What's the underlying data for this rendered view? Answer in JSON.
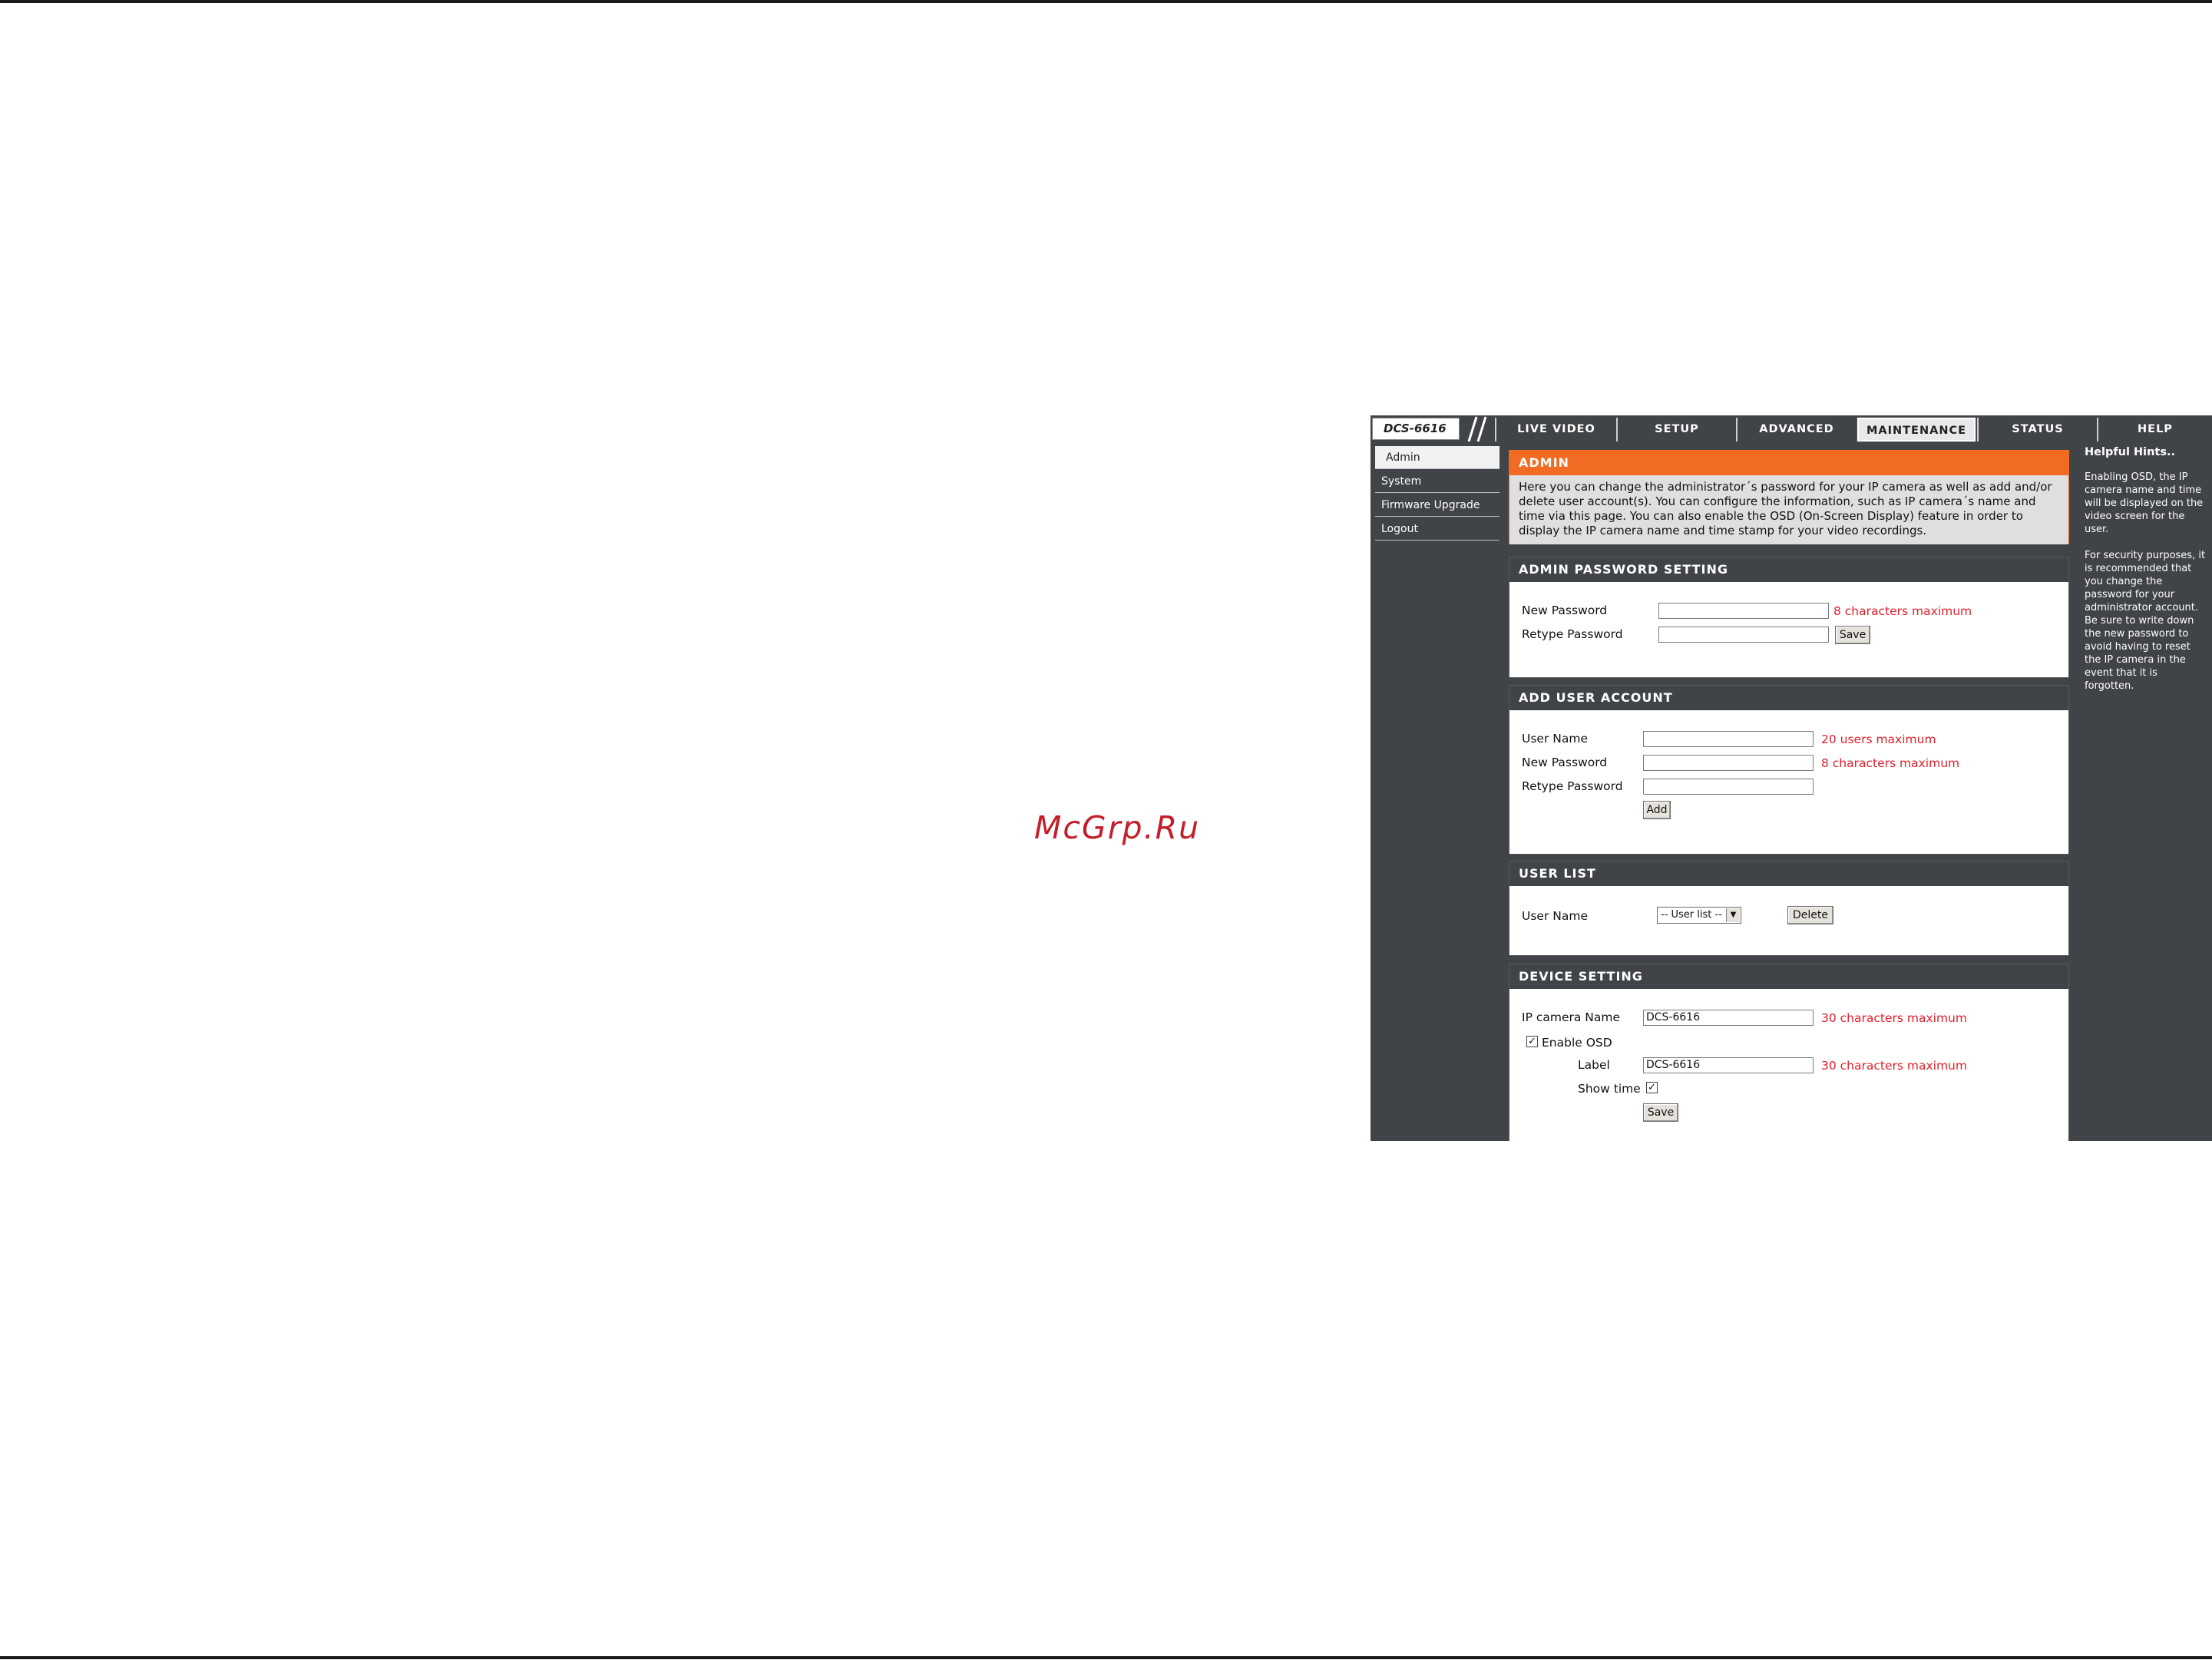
{
  "watermark": "McGrp.Ru",
  "device": {
    "model": "DCS-6616"
  },
  "tabs": [
    {
      "label": "LIVE VIDEO",
      "active": false
    },
    {
      "label": "SETUP",
      "active": false
    },
    {
      "label": "ADVANCED",
      "active": false
    },
    {
      "label": "MAINTENANCE",
      "active": true
    },
    {
      "label": "STATUS",
      "active": false
    },
    {
      "label": "HELP",
      "active": false
    }
  ],
  "sidebar": {
    "items": [
      {
        "label": "Admin",
        "active": true
      },
      {
        "label": "System",
        "active": false
      },
      {
        "label": "Firmware Upgrade",
        "active": false
      },
      {
        "label": "Logout",
        "active": false
      }
    ]
  },
  "admin": {
    "title": "ADMIN",
    "description": "Here you can change the administrator´s password for your IP camera as well as add and/or delete user account(s). You can configure the information, such as IP camera´s name and time via this page. You can also enable the OSD (On-Screen Display) feature in order to display the IP camera name and time stamp for your video recordings."
  },
  "admin_password": {
    "title": "ADMIN PASSWORD SETTING",
    "new_password_label": "New Password",
    "new_password_value": "",
    "new_password_hint": "8 characters maximum",
    "retype_password_label": "Retype Password",
    "retype_password_value": "",
    "save_label": "Save"
  },
  "add_user": {
    "title": "ADD USER ACCOUNT",
    "user_name_label": "User Name",
    "user_name_value": "",
    "user_name_hint": "20 users maximum",
    "new_password_label": "New Password",
    "new_password_value": "",
    "new_password_hint": "8 characters maximum",
    "retype_password_label": "Retype Password",
    "retype_password_value": "",
    "add_label": "Add"
  },
  "user_list": {
    "title": "USER LIST",
    "user_name_label": "User Name",
    "selected": "-- User list --",
    "delete_label": "Delete"
  },
  "device_setting": {
    "title": "DEVICE SETTING",
    "camera_name_label": "IP camera Name",
    "camera_name_value": "DCS-6616",
    "camera_name_hint": "30 characters maximum",
    "enable_osd_label": "Enable OSD",
    "enable_osd_checked": true,
    "label_label": "Label",
    "label_value": "DCS-6616",
    "label_hint": "30 characters maximum",
    "show_time_label": "Show time",
    "show_time_checked": true,
    "save_label": "Save"
  },
  "hints": {
    "title": "Helpful Hints..",
    "paragraphs": [
      "Enabling OSD, the IP camera name and time will be displayed on the video screen for the user.",
      "For security purposes, it is recommended that you change the password for your administrator account. Be sure to write down the new password to avoid having to reset the IP camera in the event that it is forgotten."
    ]
  },
  "colors": {
    "chrome": "#404348",
    "accent": "#f26b22",
    "hint_red": "#e0202c",
    "watermark": "#c41e2a"
  }
}
